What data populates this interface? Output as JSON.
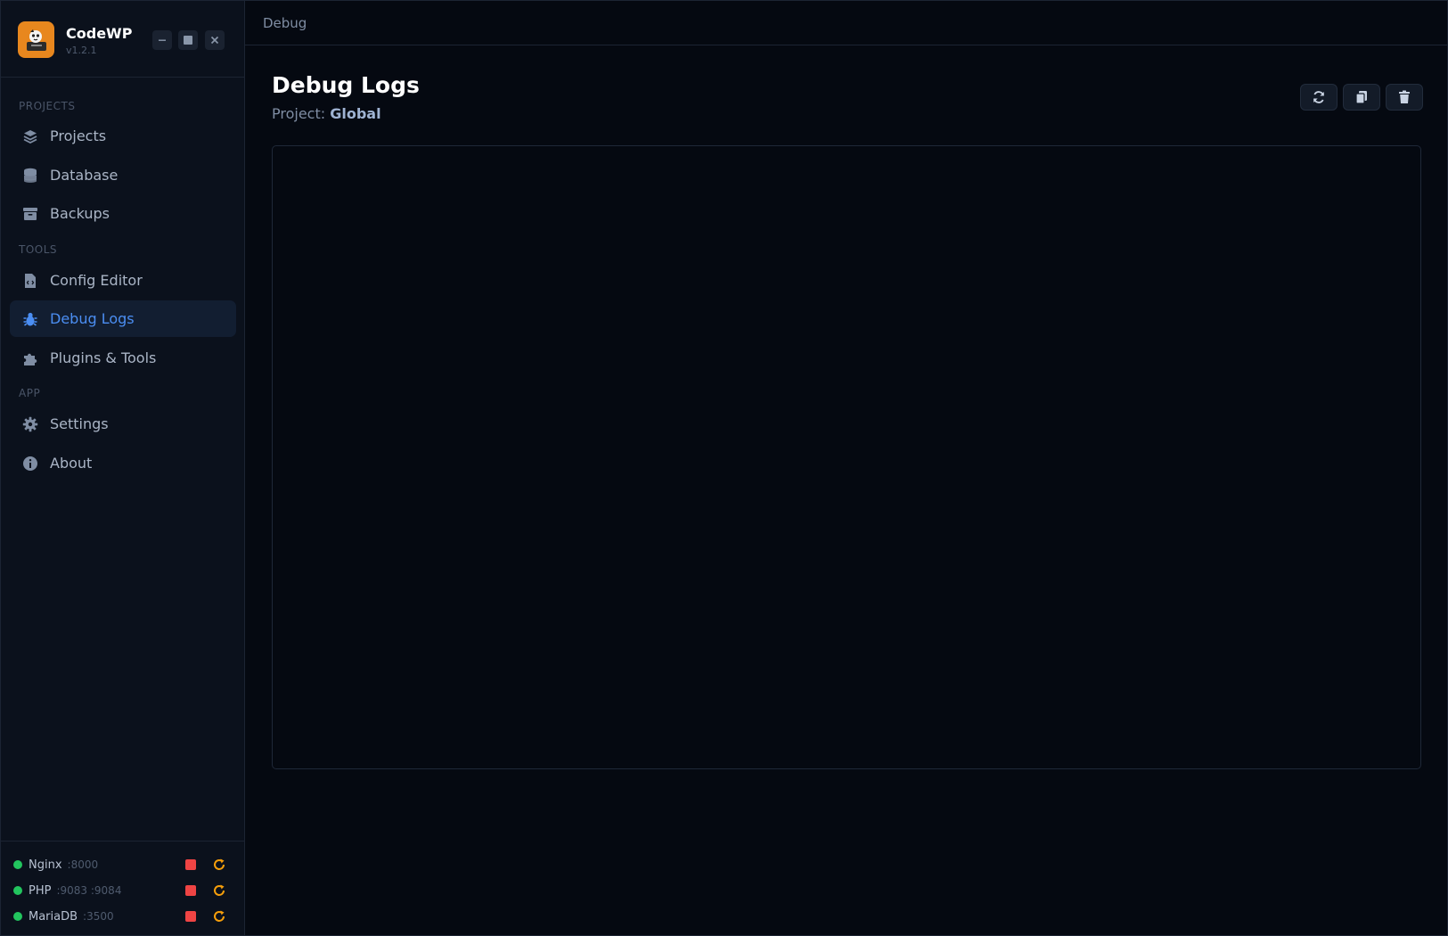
{
  "app": {
    "name": "CodeWP",
    "version": "v1.2.1"
  },
  "sidebar": {
    "sections": [
      {
        "label": "PROJECTS",
        "items": [
          {
            "label": "Projects",
            "icon": "layers-icon"
          },
          {
            "label": "Database",
            "icon": "database-icon"
          },
          {
            "label": "Backups",
            "icon": "archive-icon"
          }
        ]
      },
      {
        "label": "TOOLS",
        "items": [
          {
            "label": "Config Editor",
            "icon": "file-code-icon"
          },
          {
            "label": "Debug Logs",
            "icon": "bug-icon",
            "active": true
          },
          {
            "label": "Plugins & Tools",
            "icon": "puzzle-icon"
          }
        ]
      },
      {
        "label": "APP",
        "items": [
          {
            "label": "Settings",
            "icon": "gear-icon"
          },
          {
            "label": "About",
            "icon": "info-icon"
          }
        ]
      }
    ]
  },
  "services": [
    {
      "name": "Nginx",
      "port": ":8000",
      "status": "running"
    },
    {
      "name": "PHP",
      "port": ":9083 :9084",
      "status": "running"
    },
    {
      "name": "MariaDB",
      "port": ":3500",
      "status": "running"
    }
  ],
  "breadcrumb": "Debug",
  "page": {
    "title": "Debug Logs",
    "subtitle_prefix": "Project:",
    "project": "Global"
  },
  "colors": {
    "accent": "#4b8ef2",
    "running": "#22c55e",
    "stop": "#ef4444",
    "restart": "#f59e0b",
    "logo": "#e8871e"
  }
}
